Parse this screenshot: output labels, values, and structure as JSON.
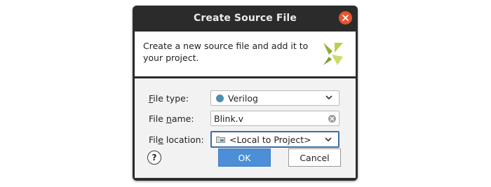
{
  "dialog": {
    "title": "Create Source File",
    "description": "Create a new source file and add it to your project."
  },
  "form": {
    "file_type": {
      "label_mnemonic": "F",
      "label_rest": "ile type:",
      "value": "Verilog",
      "icon": "verilog-dot-icon"
    },
    "file_name": {
      "label_before": "File ",
      "label_mnemonic": "n",
      "label_rest": "ame:",
      "value": "Blink.v"
    },
    "file_location": {
      "label_before": "Fil",
      "label_mnemonic": "e",
      "label_rest": " location:",
      "value": "<Local to Project>",
      "icon": "folder-icon"
    }
  },
  "buttons": {
    "help": "?",
    "ok": "OK",
    "cancel": "Cancel"
  },
  "colors": {
    "title_bar": "#2b2b2b",
    "close_button": "#e8542d",
    "ok_button": "#4c8fd6",
    "verilog_dot": "#4e8db0",
    "logo": "#a7c13c"
  }
}
